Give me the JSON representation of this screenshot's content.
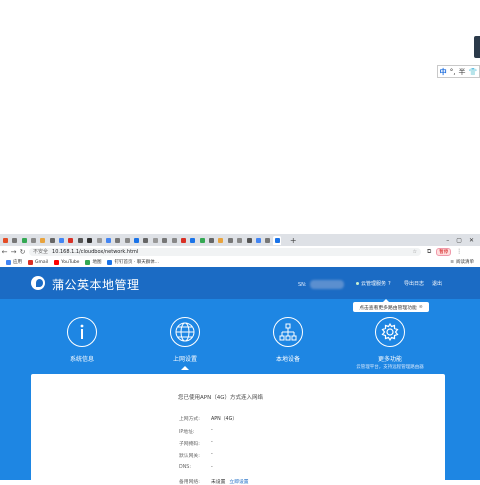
{
  "ime": {
    "mode": "中",
    "punct": "°,",
    "more": "半"
  },
  "browser": {
    "tabs": [
      {
        "color": "#e44d26"
      },
      {
        "color": "#777777"
      },
      {
        "color": "#34a853"
      },
      {
        "color": "#888888"
      },
      {
        "color": "#e8a33d"
      },
      {
        "color": "#666666"
      },
      {
        "color": "#4285f4"
      },
      {
        "color": "#d93025"
      },
      {
        "color": "#555555"
      },
      {
        "color": "#333333"
      },
      {
        "color": "#999999"
      },
      {
        "color": "#4285f4"
      },
      {
        "color": "#777777"
      },
      {
        "color": "#888888"
      },
      {
        "color": "#1a73e8"
      },
      {
        "color": "#666666"
      },
      {
        "color": "#999999"
      },
      {
        "color": "#777777"
      },
      {
        "color": "#888888"
      },
      {
        "color": "#d93025"
      },
      {
        "color": "#1a73e8"
      },
      {
        "color": "#34a853"
      },
      {
        "color": "#666666"
      },
      {
        "color": "#e8a33d"
      },
      {
        "color": "#777777"
      },
      {
        "color": "#888888"
      },
      {
        "color": "#555555"
      },
      {
        "color": "#4285f4"
      },
      {
        "color": "#777777"
      },
      {
        "color": "#1a73e8"
      }
    ],
    "active_tab_index": 29,
    "address": {
      "secure_label": "不安全",
      "url": "10.168.1.1/cloudbox/network.html"
    },
    "pause_label": "暂停",
    "bookmarks": [
      {
        "label": "应用",
        "color": "#4285f4"
      },
      {
        "label": "Gmail",
        "color": "#d93025"
      },
      {
        "label": "YouTube",
        "color": "#ff0000"
      },
      {
        "label": "地图",
        "color": "#34a853"
      },
      {
        "label": "钉钉首页 · 聊天群体...",
        "color": "#1a73e8"
      }
    ],
    "reading_list": "阅读清单"
  },
  "app": {
    "title": "蒲公英本地管理",
    "sn_label": "SN:",
    "cloud_service": "云管理服务",
    "help": "?",
    "export_log": "导出日志",
    "logout": "退出",
    "tooltip": "点击查看更多路由管理功能",
    "nav": [
      {
        "label": "系统信息",
        "sub": ""
      },
      {
        "label": "上网设置",
        "sub": ""
      },
      {
        "label": "本地设备",
        "sub": ""
      },
      {
        "label": "更多功能",
        "sub": "云管理平台，支持远程管理路由器"
      }
    ],
    "active_nav": 1,
    "panel": {
      "message": "您已使用APN（4G）方式连入网络",
      "rows": [
        {
          "k": "上网方式:",
          "v": "APN（4G）",
          "link": ""
        },
        {
          "k": "IP地址:",
          "v": "-",
          "link": ""
        },
        {
          "k": "子网掩码:",
          "v": "-",
          "link": ""
        },
        {
          "k": "默认网关:",
          "v": "-",
          "link": ""
        },
        {
          "k": "DNS:",
          "v": "-",
          "link": ""
        },
        {
          "k": "备用网络:",
          "v": "未设置",
          "link": "立即设置"
        }
      ]
    }
  },
  "colors": {
    "header": "#1b6bc4",
    "body": "#1e86e3",
    "accent": "#1b6bc4"
  }
}
